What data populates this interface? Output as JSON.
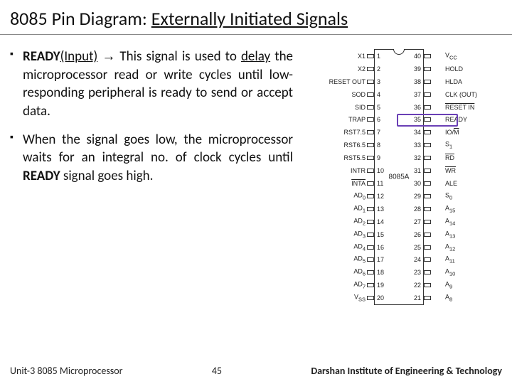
{
  "title": {
    "prefix": "8085 Pin Diagram: ",
    "underlined": "Externally Initiated Signals"
  },
  "bullets": [
    {
      "html": "<b>READY</b><span class='udl'>(Input)</span> <span class='arrow'>&#8594;</span> This signal is used to <span class='udl'>delay</span> the microprocessor read or write cycles until low-responding peripheral is ready to send or accept data."
    },
    {
      "html": "When the signal goes low, the microprocessor waits for an integral no. of clock cycles until <b>READY</b> signal goes high."
    }
  ],
  "chip": {
    "name": "8085A",
    "highlight_pin_right": 35,
    "left_pins": [
      {
        "n": 1,
        "l": "X1"
      },
      {
        "n": 2,
        "l": "X2"
      },
      {
        "n": 3,
        "l": "RESET OUT"
      },
      {
        "n": 4,
        "l": "SOD"
      },
      {
        "n": 5,
        "l": "SID"
      },
      {
        "n": 6,
        "l": "TRAP"
      },
      {
        "n": 7,
        "l": "RST7.5"
      },
      {
        "n": 8,
        "l": "RST6.5"
      },
      {
        "n": 9,
        "l": "RST5.5"
      },
      {
        "n": 10,
        "l": "INTR"
      },
      {
        "n": 11,
        "l": "<span class='ov'>INTA</span>"
      },
      {
        "n": 12,
        "l": "AD<sub>0</sub>"
      },
      {
        "n": 13,
        "l": "AD<sub>1</sub>"
      },
      {
        "n": 14,
        "l": "AD<sub>2</sub>"
      },
      {
        "n": 15,
        "l": "AD<sub>3</sub>"
      },
      {
        "n": 16,
        "l": "AD<sub>4</sub>"
      },
      {
        "n": 17,
        "l": "AD<sub>5</sub>"
      },
      {
        "n": 18,
        "l": "AD<sub>6</sub>"
      },
      {
        "n": 19,
        "l": "AD<sub>7</sub>"
      },
      {
        "n": 20,
        "l": "V<sub>SS</sub>"
      }
    ],
    "right_pins": [
      {
        "n": 40,
        "l": "V<sub>CC</sub>"
      },
      {
        "n": 39,
        "l": "HOLD"
      },
      {
        "n": 38,
        "l": "HLDA"
      },
      {
        "n": 37,
        "l": "CLK (OUT)"
      },
      {
        "n": 36,
        "l": "<span class='ov'>RESET IN</span>"
      },
      {
        "n": 35,
        "l": "READY"
      },
      {
        "n": 34,
        "l": "IO/<span class='ov'>M</span>"
      },
      {
        "n": 33,
        "l": "S<sub>1</sub>"
      },
      {
        "n": 32,
        "l": "<span class='ov'>RD</span>"
      },
      {
        "n": 31,
        "l": "<span class='ov'>WR</span>"
      },
      {
        "n": 30,
        "l": "ALE"
      },
      {
        "n": 29,
        "l": "S<sub>0</sub>"
      },
      {
        "n": 28,
        "l": "A<sub>15</sub>"
      },
      {
        "n": 27,
        "l": "A<sub>14</sub>"
      },
      {
        "n": 26,
        "l": "A<sub>13</sub>"
      },
      {
        "n": 25,
        "l": "A<sub>12</sub>"
      },
      {
        "n": 24,
        "l": "A<sub>11</sub>"
      },
      {
        "n": 23,
        "l": "A<sub>10</sub>"
      },
      {
        "n": 22,
        "l": "A<sub>9</sub>"
      },
      {
        "n": 21,
        "l": "A<sub>8</sub>"
      }
    ]
  },
  "footer": {
    "left": "Unit-3 8085 Microprocessor",
    "center": "45",
    "right": "Darshan Institute of Engineering & Technology"
  }
}
